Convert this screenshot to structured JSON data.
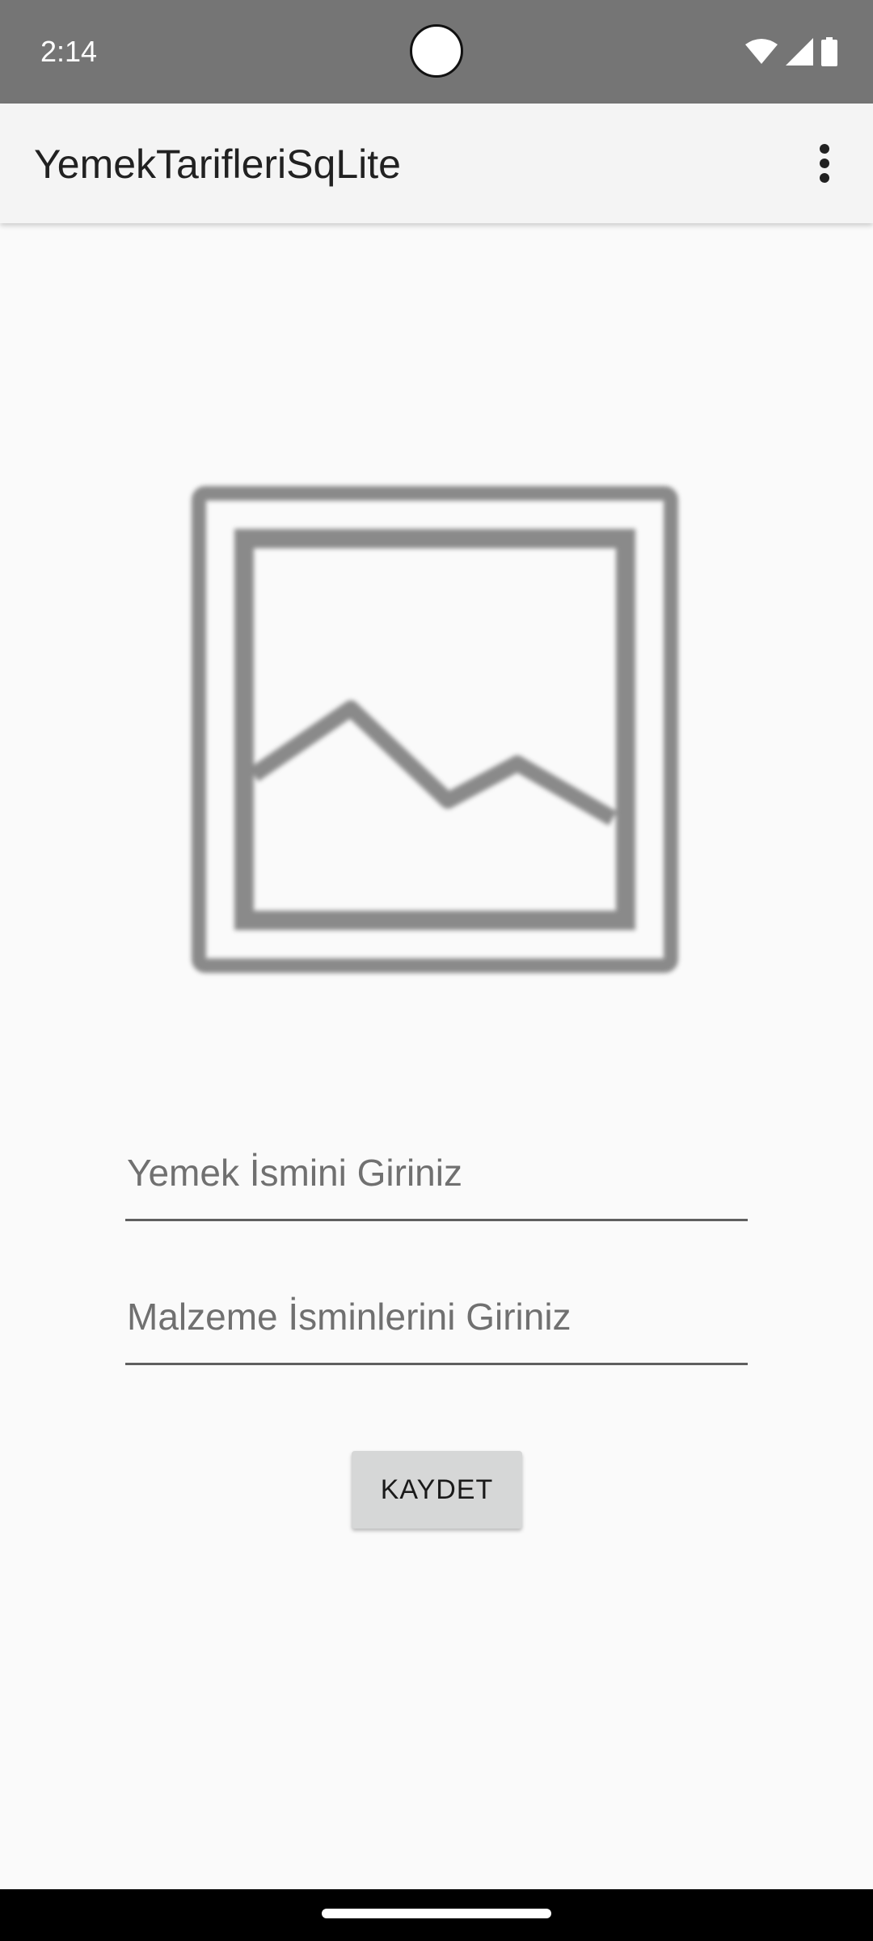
{
  "status_bar": {
    "time": "2:14",
    "icons": [
      "wifi-icon",
      "signal-icon",
      "battery-icon"
    ]
  },
  "app_bar": {
    "title": "YemekTarifleriSqLite",
    "menu_icon": "more-vert-icon"
  },
  "form": {
    "image_icon": "image-placeholder-icon",
    "food_name_placeholder": "Yemek İsmini Giriniz",
    "food_name_value": "",
    "ingredients_placeholder": "Malzeme İsminlerini Giriniz",
    "ingredients_value": "",
    "save_label": "KAYDET"
  },
  "colors": {
    "status_bar": "#757575",
    "app_bar": "#f4f4f4",
    "background": "#fafafa",
    "button": "#d6d7d7",
    "underline": "#5f5f5f"
  }
}
